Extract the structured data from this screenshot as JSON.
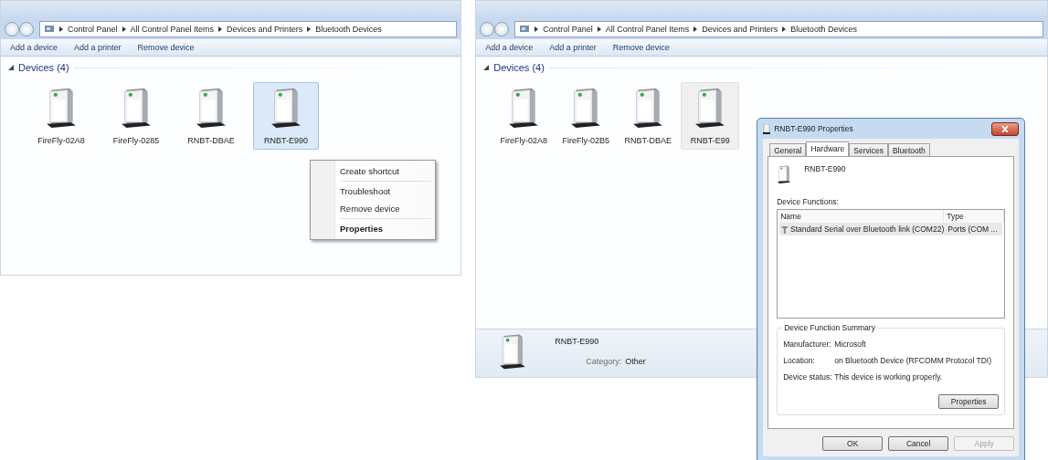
{
  "panels": [
    {
      "active": true,
      "address": [
        "Control Panel",
        "All Control Panel Items",
        "Devices and Printers",
        "Bluetooth Devices"
      ],
      "toolbar": [
        "Add a device",
        "Add a printer",
        "Remove device"
      ],
      "group": {
        "label": "Devices (4)",
        "expanded": true
      },
      "devices": [
        {
          "name": "FireFly-02A8",
          "selected": false
        },
        {
          "name": "FireFly-0285",
          "selected": false
        },
        {
          "name": "RNBT-DBAE",
          "selected": false
        },
        {
          "name": "RNBT-E990",
          "selected": true
        }
      ],
      "context_menu": {
        "items": [
          {
            "label": "Create shortcut",
            "default": false,
            "separator_before": false
          },
          {
            "label": "Troubleshoot",
            "default": false,
            "separator_before": true
          },
          {
            "label": "Remove device",
            "default": false,
            "separator_before": false
          },
          {
            "label": "Properties",
            "default": true,
            "separator_before": true
          }
        ]
      }
    },
    {
      "active": false,
      "address": [
        "Control Panel",
        "All Control Panel Items",
        "Devices and Printers",
        "Bluetooth Devices"
      ],
      "toolbar": [
        "Add a device",
        "Add a printer",
        "Remove device"
      ],
      "group": {
        "label": "Devices (4)",
        "expanded": true
      },
      "devices": [
        {
          "name": "FireFly-02A8",
          "selected": false
        },
        {
          "name": "FireFly-02B5",
          "selected": false
        },
        {
          "name": "RNBT-DBAE",
          "selected": false
        },
        {
          "name": "RNBT-E99",
          "selected": true
        }
      ],
      "details": {
        "name": "RNBT-E990",
        "category_label": "Category:",
        "category": "Other"
      },
      "dialog": {
        "title": "RNBT-E990 Properties",
        "tabs": [
          {
            "label": "General",
            "selected": false
          },
          {
            "label": "Hardware",
            "selected": true
          },
          {
            "label": "Services",
            "selected": false
          },
          {
            "label": "Bluetooth",
            "selected": false
          }
        ],
        "device_name": "RNBT-E990",
        "functions_label": "Device Functions:",
        "columns": [
          "Name",
          "Type"
        ],
        "rows": [
          {
            "name": "Standard Serial over Bluetooth link (COM22)",
            "type": "Ports (COM ...",
            "selected": true
          }
        ],
        "summary": {
          "title": "Device Function Summary",
          "fields": [
            {
              "label": "Manufacturer:",
              "value": "Microsoft"
            },
            {
              "label": "Location:",
              "value": "on Bluetooth Device (RFCOMM Protocol TDI)"
            },
            {
              "label": "Device status:",
              "value": "This device is working properly."
            }
          ],
          "button": "Properties"
        },
        "buttons": [
          {
            "label": "OK",
            "disabled": false
          },
          {
            "label": "Cancel",
            "disabled": false
          },
          {
            "label": "Apply",
            "disabled": true
          }
        ]
      }
    }
  ]
}
